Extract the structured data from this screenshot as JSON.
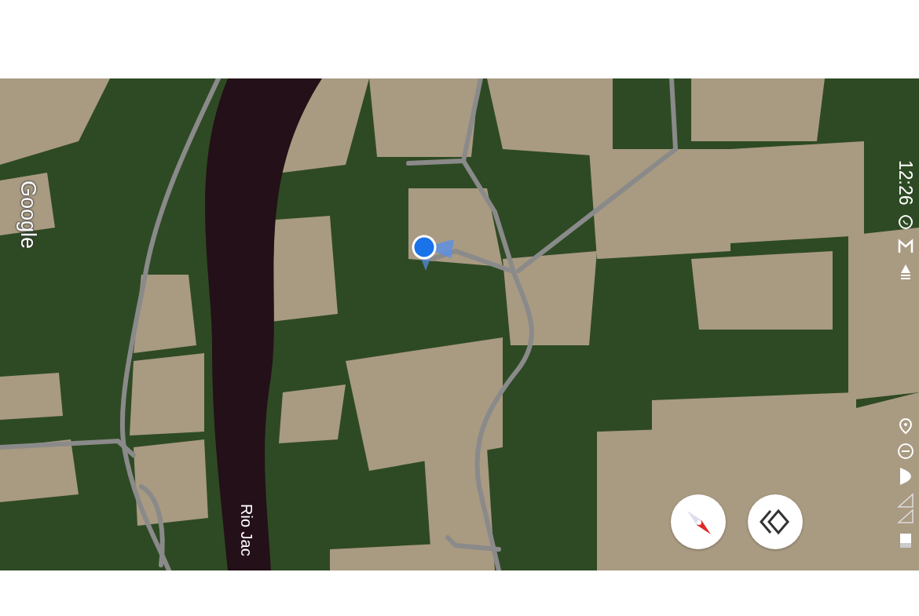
{
  "map": {
    "attribution": "Google",
    "labels": [
      {
        "text": "Rio Jac"
      }
    ]
  },
  "status_bar": {
    "time": "12:26"
  },
  "controls": [
    {
      "kind": "compass"
    },
    {
      "kind": "layers"
    }
  ]
}
